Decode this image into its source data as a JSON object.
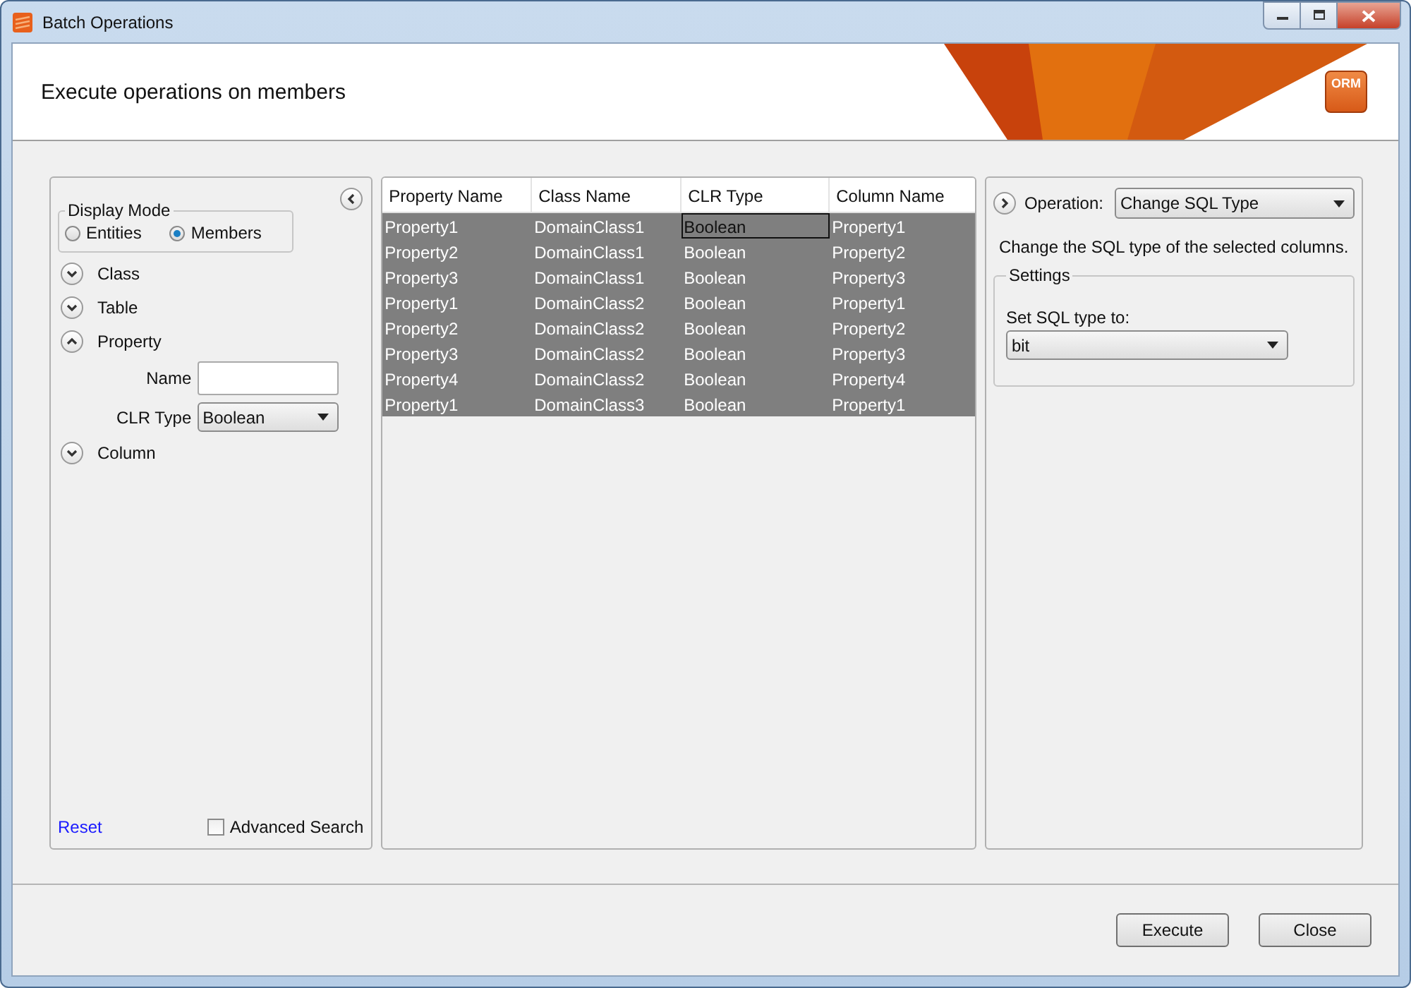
{
  "window": {
    "title": "Batch Operations"
  },
  "header": {
    "title": "Execute operations on members",
    "logo": "ORM"
  },
  "filter_panel": {
    "display_mode": {
      "label": "Display Mode",
      "options": [
        {
          "label": "Entities",
          "selected": false
        },
        {
          "label": "Members",
          "selected": true
        }
      ]
    },
    "sections": [
      {
        "label": "Class",
        "expanded": false
      },
      {
        "label": "Table",
        "expanded": false
      },
      {
        "label": "Property",
        "expanded": true,
        "fields": [
          {
            "kind": "text",
            "label": "Name"
          },
          {
            "kind": "select",
            "label": "CLR Type",
            "value": "Boolean"
          }
        ]
      },
      {
        "label": "Column",
        "expanded": false
      }
    ],
    "reset_link": "Reset",
    "advanced_search": {
      "label": "Advanced Search",
      "checked": false
    }
  },
  "table": {
    "columns": [
      "Property Name",
      "Class Name",
      "CLR Type",
      "Column Name"
    ],
    "rows": [
      {
        "selected": true,
        "cells": [
          {
            "text": "Property1",
            "focused": false
          },
          {
            "text": "DomainClass1",
            "focused": false
          },
          {
            "text": "Boolean",
            "focused": true
          },
          {
            "text": "Property1",
            "focused": false
          }
        ]
      },
      {
        "selected": true,
        "cells": [
          {
            "text": "Property2",
            "focused": false
          },
          {
            "text": "DomainClass1",
            "focused": false
          },
          {
            "text": "Boolean",
            "focused": false
          },
          {
            "text": "Property2",
            "focused": false
          }
        ]
      },
      {
        "selected": true,
        "cells": [
          {
            "text": "Property3",
            "focused": false
          },
          {
            "text": "DomainClass1",
            "focused": false
          },
          {
            "text": "Boolean",
            "focused": false
          },
          {
            "text": "Property3",
            "focused": false
          }
        ]
      },
      {
        "selected": true,
        "cells": [
          {
            "text": "Property1",
            "focused": false
          },
          {
            "text": "DomainClass2",
            "focused": false
          },
          {
            "text": "Boolean",
            "focused": false
          },
          {
            "text": "Property1",
            "focused": false
          }
        ]
      },
      {
        "selected": true,
        "cells": [
          {
            "text": "Property2",
            "focused": false
          },
          {
            "text": "DomainClass2",
            "focused": false
          },
          {
            "text": "Boolean",
            "focused": false
          },
          {
            "text": "Property2",
            "focused": false
          }
        ]
      },
      {
        "selected": true,
        "cells": [
          {
            "text": "Property3",
            "focused": false
          },
          {
            "text": "DomainClass2",
            "focused": false
          },
          {
            "text": "Boolean",
            "focused": false
          },
          {
            "text": "Property3",
            "focused": false
          }
        ]
      },
      {
        "selected": true,
        "cells": [
          {
            "text": "Property4",
            "focused": false
          },
          {
            "text": "DomainClass2",
            "focused": false
          },
          {
            "text": "Boolean",
            "focused": false
          },
          {
            "text": "Property4",
            "focused": false
          }
        ]
      },
      {
        "selected": true,
        "cells": [
          {
            "text": "Property1",
            "focused": false
          },
          {
            "text": "DomainClass3",
            "focused": false
          },
          {
            "text": "Boolean",
            "focused": false
          },
          {
            "text": "Property1",
            "focused": false
          }
        ]
      }
    ]
  },
  "operation_panel": {
    "operation_label": "Operation:",
    "operation": "Change SQL Type",
    "description": "Change the SQL type of the selected columns.",
    "settings": {
      "label": "Settings",
      "field_label": "Set SQL type to:",
      "value": "bit"
    }
  },
  "buttons": [
    "Execute",
    "Close"
  ]
}
